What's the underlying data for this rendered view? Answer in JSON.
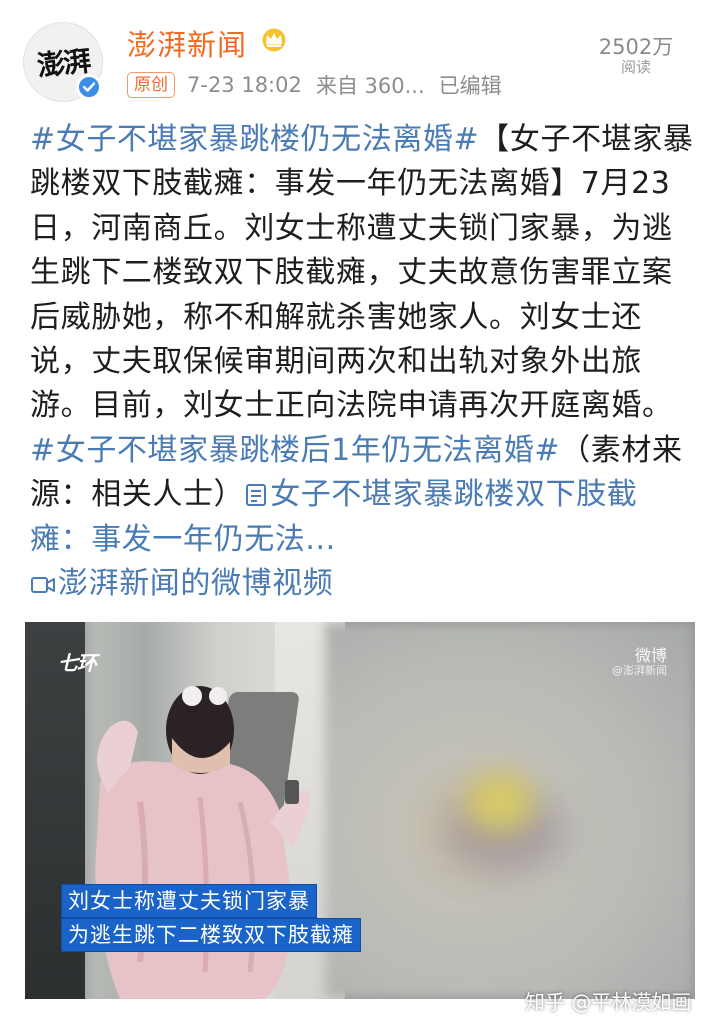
{
  "header": {
    "avatar_text": "澎湃",
    "account_name": "澎湃新闻",
    "original_badge": "原创",
    "time": "7-23 18:02",
    "source": "来自 360...",
    "edited": "已编辑",
    "reads_count": "2502万",
    "reads_label": "阅读"
  },
  "post": {
    "hashtag1": "#女子不堪家暴跳楼仍无法离婚#",
    "body1": "【女子不堪家暴跳楼双下肢截瘫：事发一年仍无法离婚】7月23日，河南商丘。刘女士称遭丈夫锁门家暴，为逃生跳下二楼致双下肢截瘫，丈夫故意伤害罪立案后威胁她，称不和解就杀害她家人。刘女士还说，丈夫取保候审期间两次和出轨对象外出旅游。目前，刘女士正向法院申请再次开庭离婚。",
    "hashtag2": "#女子不堪家暴跳楼后1年仍无法离婚#",
    "body2": "（素材来源：相关人士）",
    "article_link": "女子不堪家暴跳楼双下肢截瘫：事发一年仍无法...",
    "video_link": "澎湃新闻的微博视频"
  },
  "media": {
    "channel_logo": "七环",
    "weibo_mark": "微博",
    "weibo_sub": "@澎湃新闻",
    "caption1": "刘女士称遭丈夫锁门家暴",
    "caption2": "为逃生跳下二楼致双下肢截瘫"
  },
  "watermark": "知乎 @平林漠如画",
  "colors": {
    "account_orange": "#f26a20",
    "link_blue": "#4a7bb5",
    "caption_blue": "#1a63c8",
    "verified_blue": "#3b8ee8"
  },
  "icons": [
    "crown-icon",
    "verified-icon",
    "article-icon",
    "video-icon"
  ]
}
